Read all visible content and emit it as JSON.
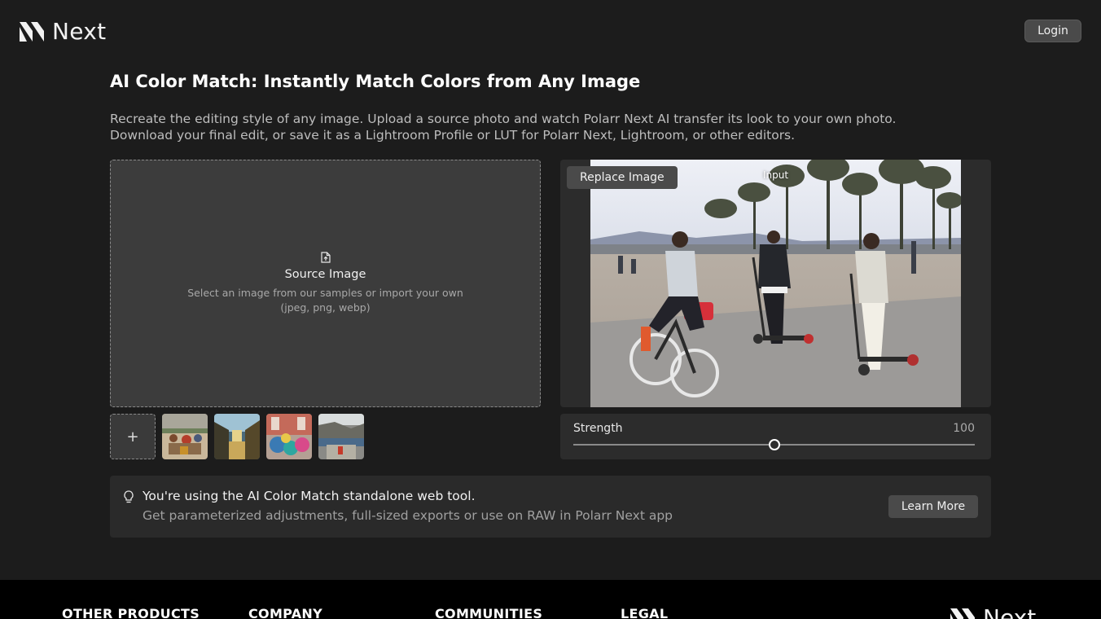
{
  "header": {
    "logo_text": "Next",
    "login_label": "Login"
  },
  "page": {
    "title": "AI Color Match: Instantly Match Colors from Any Image",
    "description": "Recreate the editing style of any image. Upload a source photo and watch Polarr Next AI transfer its look to your own photo. Download your final edit, or save it as a Lightroom Profile or LUT for Polarr Next, Lightroom, or other editors."
  },
  "source": {
    "icon": "file-upload-icon",
    "title": "Source Image",
    "hint_line1": "Select an image from our samples or import your own",
    "hint_line2": "(jpeg, png, webp)",
    "add_label": "+",
    "samples": [
      "sample-crowd",
      "sample-street",
      "sample-flowers",
      "sample-coast"
    ]
  },
  "preview": {
    "replace_label": "Replace Image",
    "input_label": "Input"
  },
  "strength": {
    "label": "Strength",
    "value": 100,
    "value_text": "100",
    "slider_fraction": 0.5
  },
  "info": {
    "icon": "lightbulb-icon",
    "title": "You're using the AI Color Match standalone web tool.",
    "subtitle": "Get parameterized adjustments, full-sized exports or use on RAW in Polarr Next app",
    "learn_more_label": "Learn More"
  },
  "footer": {
    "headings": [
      "OTHER PRODUCTS",
      "COMPANY",
      "COMMUNITIES",
      "LEGAL"
    ],
    "logo_text": "Next"
  },
  "colors": {
    "background": "#1c1c1c",
    "panel": "#2c2c2c",
    "button": "#4a4a4a",
    "footer": "#000000"
  }
}
